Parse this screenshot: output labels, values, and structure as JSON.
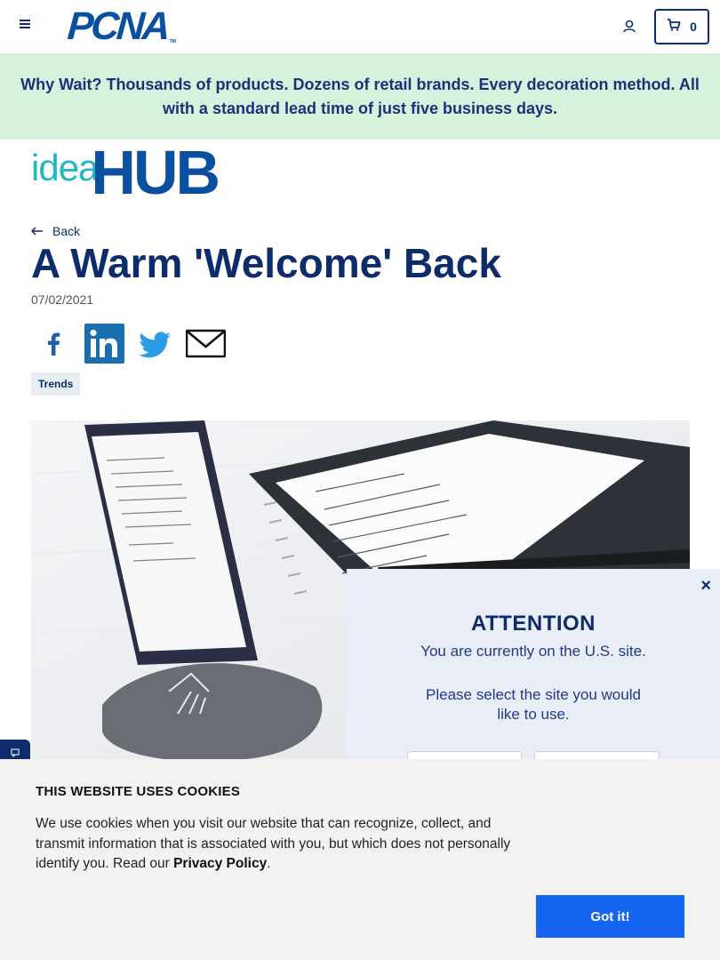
{
  "header": {
    "logo_text": "PCNA",
    "logo_tm": "TM",
    "cart_count": "0"
  },
  "banner": {
    "text": "Why Wait? Thousands of products. Dozens of retail brands. Every decoration method. All with a standard lead time of just five business days."
  },
  "ideahub": {
    "idea": "idea",
    "hub": "HUB"
  },
  "article": {
    "back_label": "Back",
    "title": "A Warm 'Welcome' Back",
    "date": "07/02/2021",
    "tag": "Trends"
  },
  "attention": {
    "title": "ATTENTION",
    "line1": "You are currently on the U.S. site.",
    "line2": "Please select the site you would",
    "line3": "like to use.",
    "close": "×"
  },
  "cookie": {
    "title": "THIS WEBSITE USES COOKIES",
    "text": "We use cookies when you visit our website that can recognize, collect, and transmit information that is associated with you, but which does not personally identify you. Read our",
    "link": "Privacy Policy",
    "period": ".",
    "button": "Got it!"
  },
  "colors": {
    "brand_blue": "#0a4fa0",
    "navy": "#0e2c6b",
    "teal": "#22b6c2",
    "banner_bg": "#d4f2dc",
    "cookie_button": "#1565f0"
  },
  "icons": [
    "menu-icon",
    "user-icon",
    "cart-icon",
    "back-arrow-icon",
    "facebook-icon",
    "linkedin-icon",
    "twitter-icon",
    "email-icon",
    "close-icon"
  ]
}
